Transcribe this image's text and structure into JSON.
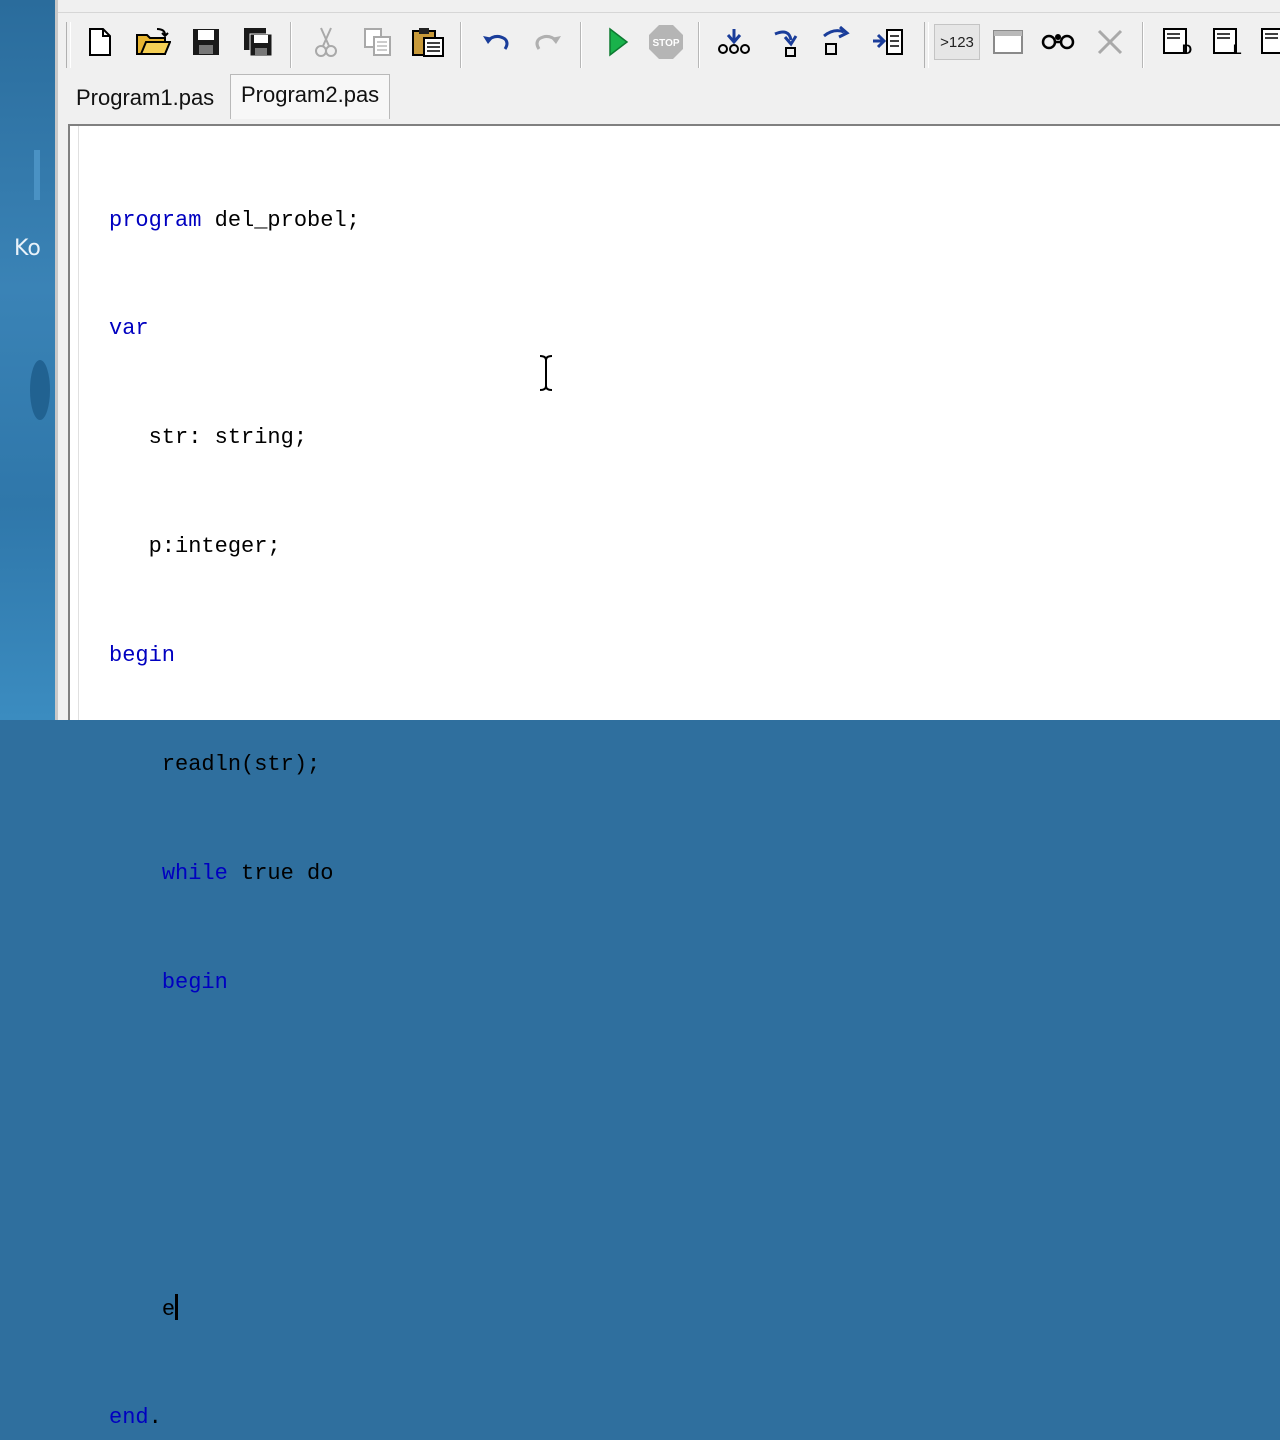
{
  "desktop": {
    "label": "Ko"
  },
  "toolbar": {
    "buttons": [
      {
        "icon": "new-file-icon"
      },
      {
        "icon": "open-folder-icon"
      },
      {
        "icon": "save-icon"
      },
      {
        "icon": "save-all-icon"
      },
      {
        "icon": "cut-icon"
      },
      {
        "icon": "copy-icon"
      },
      {
        "icon": "paste-icon"
      },
      {
        "icon": "undo-icon"
      },
      {
        "icon": "redo-icon"
      },
      {
        "icon": "run-icon"
      },
      {
        "icon": "stop-icon"
      },
      {
        "icon": "step-into-icon"
      },
      {
        "icon": "step-over-icon"
      },
      {
        "icon": "step-out-icon"
      },
      {
        "icon": "run-to-cursor-icon"
      },
      {
        "icon": "evaluate-icon"
      },
      {
        "icon": "window-icon"
      },
      {
        "icon": "watch-icon"
      },
      {
        "icon": "clear-icon"
      },
      {
        "icon": "debug-d-icon"
      },
      {
        "icon": "debug-l-icon"
      },
      {
        "icon": "debug-more-icon"
      }
    ],
    "evaluate_label": ">123",
    "stop_label": "STOP"
  },
  "tabs": [
    {
      "label": "Program1.pas",
      "active": false
    },
    {
      "label": "Program2.pas",
      "active": true
    }
  ],
  "editor": {
    "lines": [
      {
        "indent": "",
        "kw": "program",
        "rest": " del_probel;"
      },
      {
        "indent": "",
        "kw": "var",
        "rest": ""
      },
      {
        "indent": "   ",
        "kw": "",
        "rest": "str: string;"
      },
      {
        "indent": "   ",
        "kw": "",
        "rest": "p:integer;"
      },
      {
        "indent": "",
        "kw": "begin",
        "rest": ""
      },
      {
        "indent": "    ",
        "kw": "",
        "rest": "readln(str);"
      },
      {
        "indent": "    ",
        "kw": "while",
        "rest": " true do"
      },
      {
        "indent": "    ",
        "kw": "begin",
        "rest": ""
      },
      {
        "indent": "",
        "kw": "",
        "rest": ""
      },
      {
        "indent": "",
        "kw": "",
        "rest": ""
      },
      {
        "indent": "    ",
        "kw": "",
        "rest": "e"
      },
      {
        "indent": "",
        "kw": "end",
        "rest": "."
      }
    ]
  }
}
